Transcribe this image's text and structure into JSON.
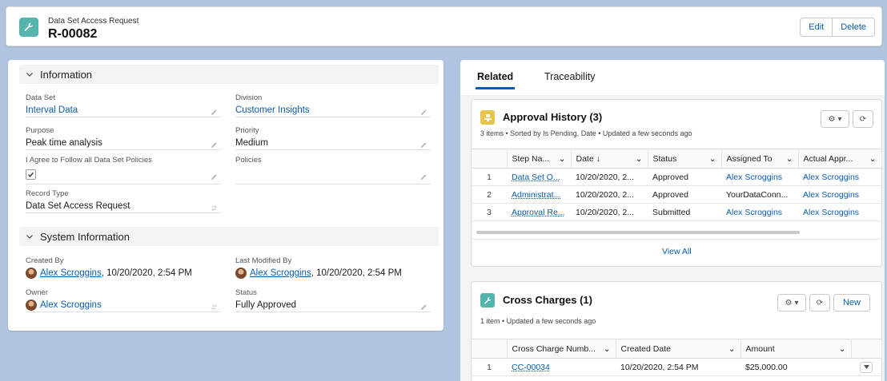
{
  "header": {
    "object_type": "Data Set Access Request",
    "record_name": "R-00082",
    "edit_label": "Edit",
    "delete_label": "Delete"
  },
  "information": {
    "title": "Information",
    "data_set_label": "Data Set",
    "data_set_value": "Interval Data",
    "division_label": "Division",
    "division_value": "Customer Insights",
    "purpose_label": "Purpose",
    "purpose_value": "Peak time analysis",
    "priority_label": "Priority",
    "priority_value": "Medium",
    "agree_label": "I Agree to Follow all Data Set Policies",
    "agree_checked": true,
    "policies_label": "Policies",
    "policies_value": "",
    "record_type_label": "Record Type",
    "record_type_value": "Data Set Access Request"
  },
  "system_information": {
    "title": "System Information",
    "created_by_label": "Created By",
    "created_by_user": "Alex Scroggins",
    "created_by_date": ", 10/20/2020, 2:54 PM",
    "last_modified_label": "Last Modified By",
    "last_modified_user": "Alex Scroggins",
    "last_modified_date": ", 10/20/2020, 2:54 PM",
    "owner_label": "Owner",
    "owner_value": "Alex Scroggins",
    "status_label": "Status",
    "status_value": "Fully Approved"
  },
  "tabs": {
    "related": "Related",
    "traceability": "Traceability"
  },
  "approval_history": {
    "title": "Approval History (3)",
    "subtitle": "3 items • Sorted by Is Pending, Date • Updated a few seconds ago",
    "columns": [
      "Step Na...",
      "Date ↓",
      "Status",
      "Assigned To",
      "Actual Appr..."
    ],
    "rows": [
      {
        "num": "1",
        "step": "Data Set O...",
        "date": "10/20/2020, 2...",
        "status": "Approved",
        "assigned": "Alex Scroggins",
        "actual": "Alex Scroggins"
      },
      {
        "num": "2",
        "step": "Administrat...",
        "date": "10/20/2020, 2...",
        "status": "Approved",
        "assigned": "YourDataConn...",
        "actual": "Alex Scroggins"
      },
      {
        "num": "3",
        "step": "Approval Re...",
        "date": "10/20/2020, 2...",
        "status": "Submitted",
        "assigned": "Alex Scroggins",
        "actual": "Alex Scroggins"
      }
    ],
    "view_all": "View All"
  },
  "cross_charges": {
    "title": "Cross Charges (1)",
    "subtitle": "1 item • Updated a few seconds ago",
    "new_label": "New",
    "columns": [
      "Cross Charge Numb...",
      "Created Date",
      "Amount"
    ],
    "rows": [
      {
        "num": "1",
        "number": "CC-00034",
        "created": "10/20/2020, 2:54 PM",
        "amount": "$25,000.00"
      }
    ]
  },
  "colors": {
    "brand_link": "#0b5cab",
    "record_icon": "#53b5ac",
    "approval_icon": "#e7c44a",
    "background": "#b0c4df"
  }
}
